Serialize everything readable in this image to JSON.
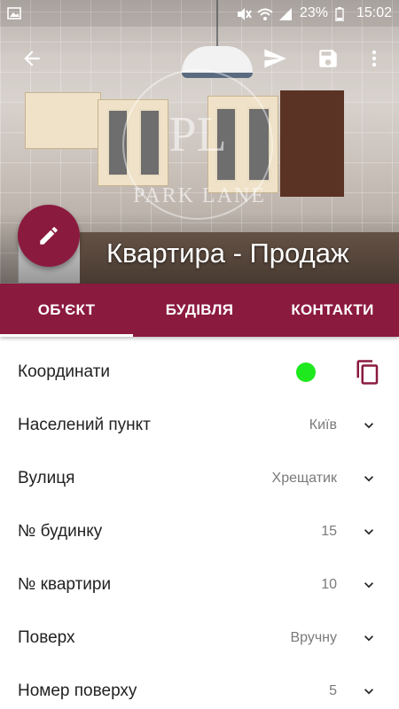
{
  "status_bar": {
    "battery_percent": "23%",
    "time": "15:02",
    "icons": [
      "image-icon",
      "mute-icon",
      "wifi-icon",
      "signal-icon",
      "battery-icon"
    ]
  },
  "toolbar": {
    "back_icon": "arrow-back-icon",
    "send_icon": "send-icon",
    "save_icon": "save-icon",
    "more_icon": "more-vert-icon"
  },
  "hero": {
    "title": "Квартира - Продаж",
    "watermark_monogram": "PL",
    "watermark_text": "PARK LANE"
  },
  "fab": {
    "icon": "edit-pencil-icon",
    "color": "#8b1a3f"
  },
  "tabs": [
    {
      "label": "ОБ'ЄКТ",
      "active": true
    },
    {
      "label": "БУДІВЛЯ",
      "active": false
    },
    {
      "label": "КОНТАКТИ",
      "active": false
    }
  ],
  "accent_color": "#8b1a3f",
  "fields": {
    "coordinates": {
      "label": "Координати",
      "status_color": "#1ee81e",
      "action_icon": "copy-icon"
    },
    "locality": {
      "label": "Населений пункт",
      "value": "Київ"
    },
    "street": {
      "label": "Вулиця",
      "value": "Хрещатик"
    },
    "house_number": {
      "label": "№ будинку",
      "value": "15"
    },
    "apartment_number": {
      "label": "№ квартири",
      "value": "10"
    },
    "floor": {
      "label": "Поверх",
      "value": "Вручну"
    },
    "floor_number": {
      "label": "Номер поверху",
      "value": "5"
    }
  }
}
